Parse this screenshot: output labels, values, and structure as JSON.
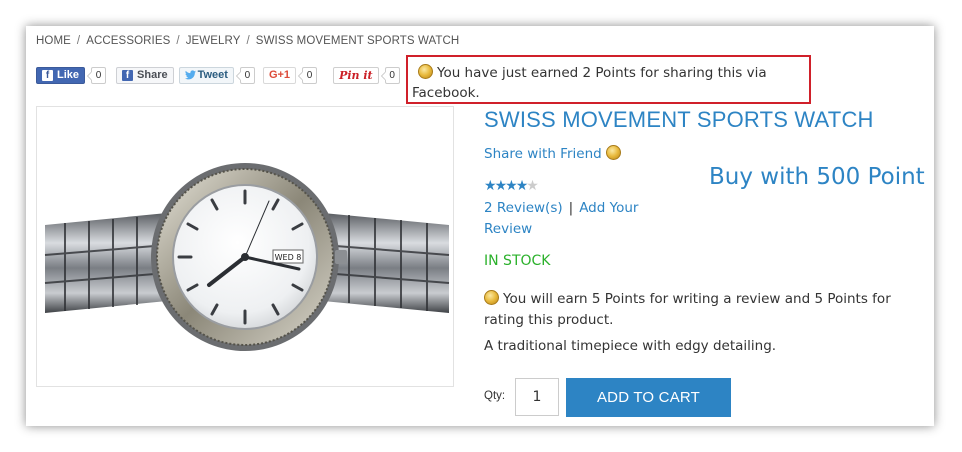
{
  "breadcrumb": {
    "items": [
      "HOME",
      "ACCESSORIES",
      "JEWELRY",
      "SWISS MOVEMENT SPORTS WATCH"
    ],
    "separator": "/"
  },
  "social": {
    "fb_like": {
      "label": "Like",
      "count": "0"
    },
    "fb_share": {
      "label": "Share"
    },
    "tweet": {
      "label": "Tweet",
      "count": "0"
    },
    "gplus": {
      "label": "G+1",
      "count": "0"
    },
    "pinit": {
      "label": "Pin it",
      "count": "0"
    }
  },
  "notice": {
    "text": "You have just earned 2 Points for sharing this via Facebook.",
    "border_color": "#d0202a"
  },
  "product": {
    "title": "SWISS MOVEMENT SPORTS WATCH",
    "share_with_friend": "Share with Friend",
    "buy_with_points": "Buy with 500 Point",
    "rating_stars": 4,
    "rating_max": 5,
    "reviews_link": "2 Review(s)",
    "review_separator": "|",
    "add_review_link": "Add Your Review",
    "stock_status": "IN STOCK",
    "earn_points_text": "You will earn 5 Points for writing a review and 5 Points for rating this product.",
    "description": "A traditional timepiece with edgy detailing.",
    "qty_label": "Qty:",
    "qty_value": "1",
    "add_to_cart": "ADD TO CART",
    "image_date_label": "WED 8"
  },
  "colors": {
    "accent": "#2d84c4",
    "stock": "#2bb12b",
    "facebook": "#4267b2"
  },
  "icons": [
    "facebook-icon",
    "twitter-bird-icon",
    "points-coin-icon",
    "star-icon"
  ]
}
